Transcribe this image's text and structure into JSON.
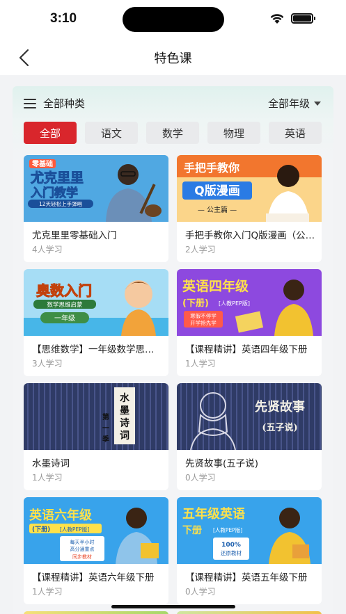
{
  "status": {
    "time": "3:10"
  },
  "nav": {
    "title": "特色课"
  },
  "filter": {
    "category_label": "全部种类",
    "grade_label": "全部年级"
  },
  "tabs": [
    "全部",
    "语文",
    "数学",
    "物理",
    "英语"
  ],
  "courses": [
    {
      "title": "尤克里里零基础入门",
      "learners": "4人学习",
      "thumb_text": [
        "零基础",
        "尤克里里",
        "入门教学",
        "12天轻松上手弹唱"
      ],
      "thumb_colors": [
        "#2e8fd8",
        "#7ac8ef"
      ]
    },
    {
      "title": "手把手教你入门Q版漫画（公主篇）",
      "learners": "2人学习",
      "thumb_text": [
        "手把手教你",
        "Q版漫画",
        "— 公主篇 —"
      ],
      "thumb_colors": [
        "#f2762e",
        "#fbd58a"
      ]
    },
    {
      "title": "【思维数学】一年级数学思维启蒙",
      "learners": "3人学习",
      "thumb_text": [
        "奥数入门",
        "数学思维启蒙",
        "一年级"
      ],
      "thumb_colors": [
        "#47b6e8",
        "#a6ddf5"
      ]
    },
    {
      "title": "【课程精讲】英语四年级下册",
      "learners": "1人学习",
      "thumb_text": [
        "英语四年级",
        "(下册)",
        "[人教PEP版]",
        "寒假不停学",
        "开学抢先学"
      ],
      "thumb_colors": [
        "#7a2fd6",
        "#b27cf0"
      ]
    },
    {
      "title": "水墨诗词",
      "learners": "1人学习",
      "thumb_text": [
        "水墨诗词",
        "第一季"
      ],
      "thumb_colors": [
        "#2f3b66",
        "#48548a"
      ]
    },
    {
      "title": "先贤故事(五子说)",
      "learners": "0人学习",
      "thumb_text": [
        "先贤故事",
        "(五子说)"
      ],
      "thumb_colors": [
        "#2f3b66",
        "#48548a"
      ]
    },
    {
      "title": "【课程精讲】英语六年级下册",
      "learners": "1人学习",
      "thumb_text": [
        "英语六年级",
        "(下册)",
        "[人教PEP版]",
        "每天半小时",
        "高分通重点",
        "同步教材"
      ],
      "thumb_colors": [
        "#1c93e6",
        "#6cc2f4"
      ]
    },
    {
      "title": "【课程精讲】英语五年级下册",
      "learners": "0人学习",
      "thumb_text": [
        "五年级英语",
        "下册",
        "[人教PEP版]",
        "100%",
        "还原教材"
      ],
      "thumb_colors": [
        "#1c93e6",
        "#6cc2f4"
      ]
    }
  ],
  "colors": {
    "accent": "#d9262c",
    "panel_tint": "#e0f1ee"
  }
}
